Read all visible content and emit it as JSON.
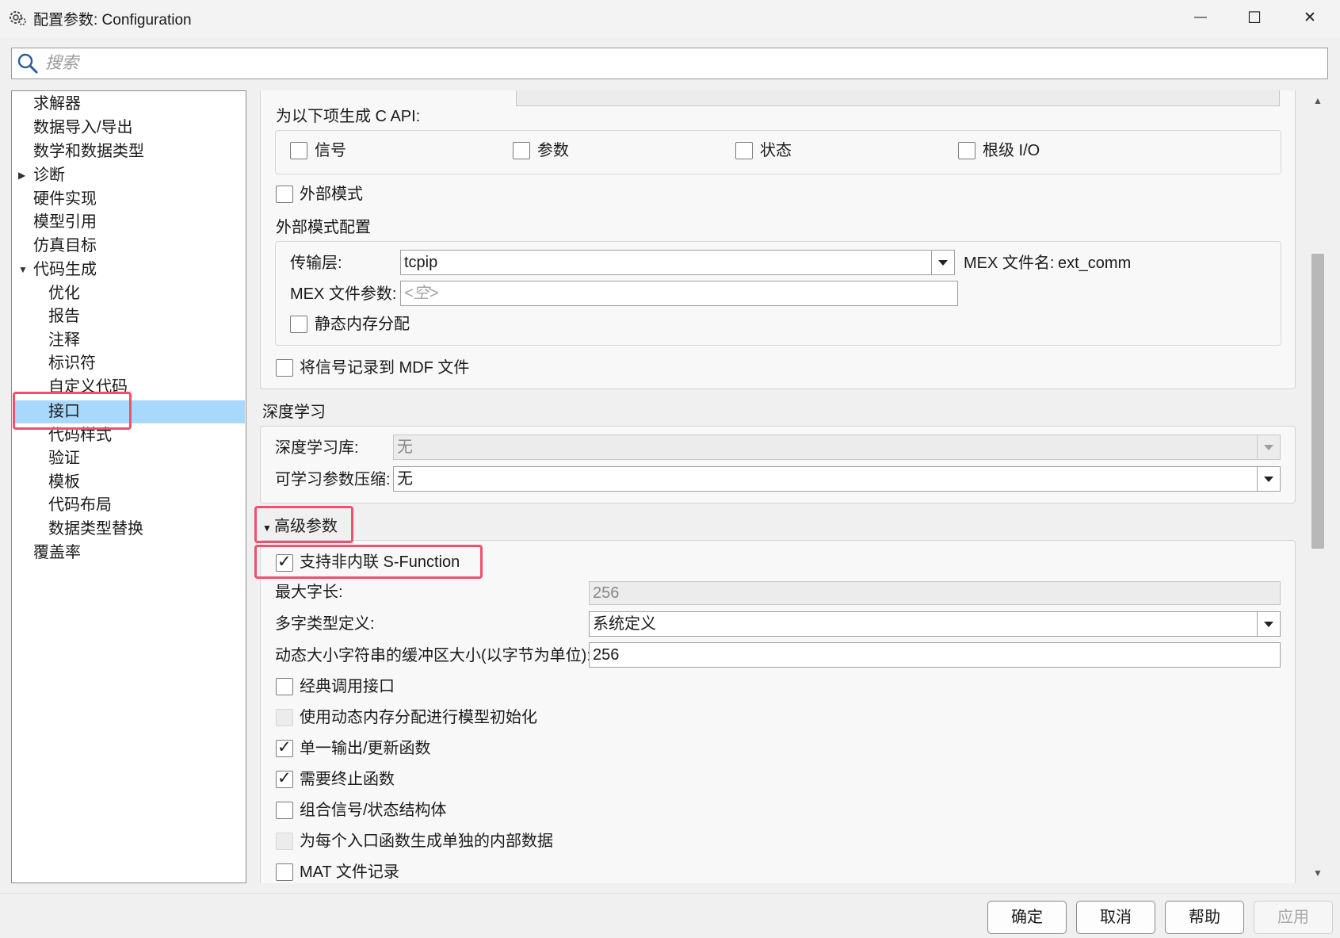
{
  "window": {
    "title": "配置参数: Configuration",
    "minimize_symbol": "—",
    "maximize_symbol": "☐",
    "close_symbol": "✕"
  },
  "search": {
    "placeholder": "搜索"
  },
  "tree": {
    "expand_symbol": "▶",
    "collapse_symbol": "▼",
    "items": [
      {
        "label": "求解器"
      },
      {
        "label": "数据导入/导出"
      },
      {
        "label": "数学和数据类型"
      },
      {
        "label": "诊断"
      },
      {
        "label": "硬件实现"
      },
      {
        "label": "模型引用"
      },
      {
        "label": "仿真目标"
      },
      {
        "label": "代码生成"
      },
      {
        "label": "优化"
      },
      {
        "label": "报告"
      },
      {
        "label": "注释"
      },
      {
        "label": "标识符"
      },
      {
        "label": "自定义代码"
      },
      {
        "label": "接口"
      },
      {
        "label": "代码样式"
      },
      {
        "label": "验证"
      },
      {
        "label": "模板"
      },
      {
        "label": "代码布局"
      },
      {
        "label": "数据类型替换"
      },
      {
        "label": "覆盖率"
      }
    ]
  },
  "c_api": {
    "heading": "为以下项生成 C API:",
    "signals": "信号",
    "params": "参数",
    "states": "状态",
    "root_io": "根级 I/O"
  },
  "external_mode": {
    "checkbox": "外部模式",
    "config_heading": "外部模式配置",
    "transport_label": "传输层:",
    "transport_value": "tcpip",
    "mex_filename_label": "MEX 文件名:",
    "mex_filename_value": "ext_comm",
    "mex_args_label": "MEX 文件参数:",
    "mex_args_placeholder": "<空>",
    "static_mem": "静态内存分配",
    "log_mdf": "将信号记录到 MDF 文件"
  },
  "deep_learning": {
    "heading": "深度学习",
    "library_label": "深度学习库:",
    "library_value": "无",
    "compression_label": "可学习参数压缩:",
    "compression_value": "无"
  },
  "advanced": {
    "heading": "高级参数",
    "support_sfunction": "支持非内联 S-Function",
    "max_word_label": "最大字长:",
    "max_word_value": "256",
    "multiword_label": "多字类型定义:",
    "multiword_value": "系统定义",
    "buffer_label": "动态大小字符串的缓冲区大小(以字节为单位):",
    "buffer_value": "256",
    "classic_interface": "经典调用接口",
    "dynamic_mem_init": "使用动态内存分配进行模型初始化",
    "single_output_update": "单一输出/更新函数",
    "terminate_required": "需要终止函数",
    "combine_struct": "组合信号/状态结构体",
    "separate_internal": "为每个入口函数生成单独的内部数据",
    "mat_logging": "MAT 文件记录"
  },
  "buttons": {
    "ok": "确定",
    "cancel": "取消",
    "help": "帮助",
    "apply": "应用"
  }
}
